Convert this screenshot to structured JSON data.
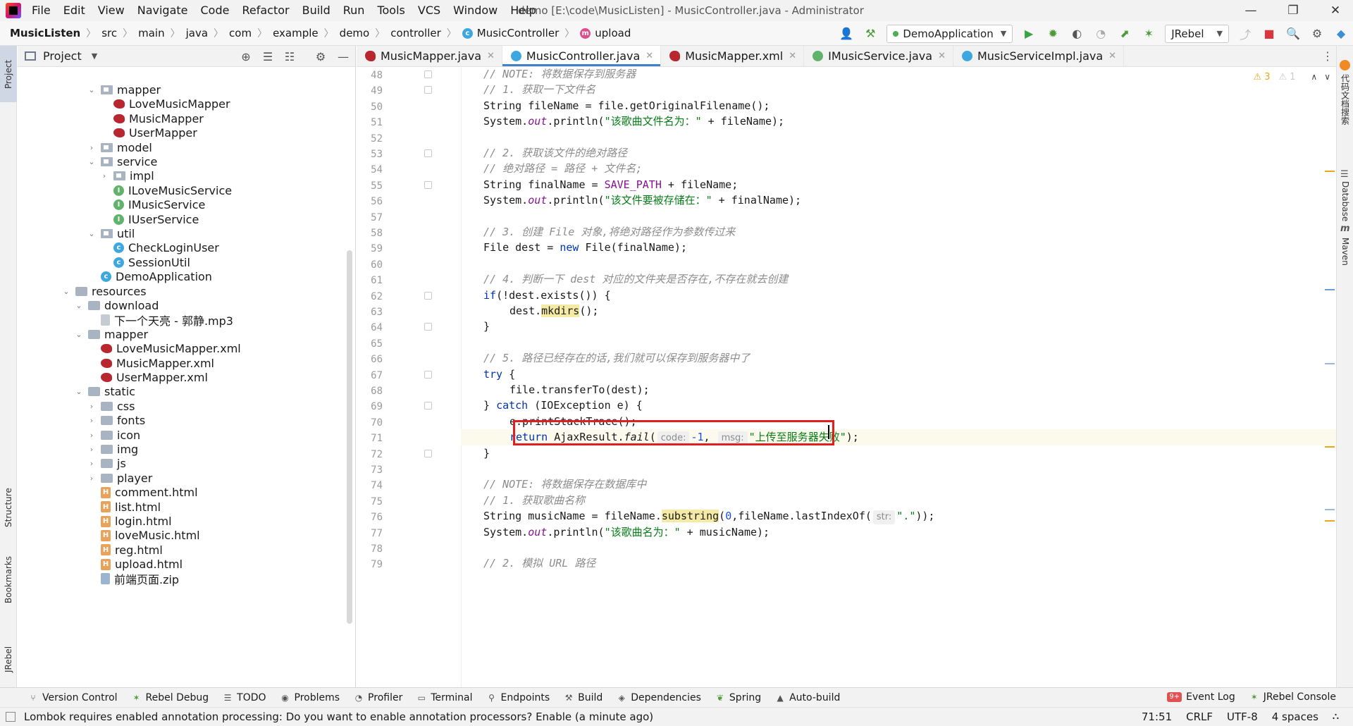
{
  "menu": {
    "items": [
      "File",
      "Edit",
      "View",
      "Navigate",
      "Code",
      "Refactor",
      "Build",
      "Run",
      "Tools",
      "VCS",
      "Window",
      "Help"
    ],
    "window_title": "demo [E:\\code\\MusicListen] - MusicController.java - Administrator"
  },
  "breadcrumb": {
    "project": "MusicListen",
    "parts": [
      "src",
      "main",
      "java",
      "com",
      "example",
      "demo",
      "controller"
    ],
    "class_name": "MusicController",
    "method_name": "upload"
  },
  "toolbar": {
    "run_config": "DemoApplication",
    "jrebel": "JRebel"
  },
  "left_strip": {
    "project_tab": "Project",
    "structure_tab": "Structure",
    "bookmarks_tab": "Bookmarks",
    "jrebel_tab": "JRebel"
  },
  "project_panel": {
    "title": "Project",
    "tree": [
      {
        "label": "mapper",
        "icon": "package",
        "depth": 1,
        "arrow": "open"
      },
      {
        "label": "LoveMusicMapper",
        "icon": "mybatis-bird",
        "depth": 2,
        "arrow": "none"
      },
      {
        "label": "MusicMapper",
        "icon": "mybatis-bird",
        "depth": 2,
        "arrow": "none"
      },
      {
        "label": "UserMapper",
        "icon": "mybatis-bird",
        "depth": 2,
        "arrow": "none"
      },
      {
        "label": "model",
        "icon": "package",
        "depth": 1,
        "arrow": "closed"
      },
      {
        "label": "service",
        "icon": "package",
        "depth": 1,
        "arrow": "open"
      },
      {
        "label": "impl",
        "icon": "package",
        "depth": 2,
        "arrow": "closed"
      },
      {
        "label": "ILoveMusicService",
        "icon": "interface",
        "depth": 2,
        "arrow": "none"
      },
      {
        "label": "IMusicService",
        "icon": "interface",
        "depth": 2,
        "arrow": "none"
      },
      {
        "label": "IUserService",
        "icon": "interface",
        "depth": 2,
        "arrow": "none"
      },
      {
        "label": "util",
        "icon": "package",
        "depth": 1,
        "arrow": "open"
      },
      {
        "label": "CheckLoginUser",
        "icon": "class",
        "depth": 2,
        "arrow": "none"
      },
      {
        "label": "SessionUtil",
        "icon": "class",
        "depth": 2,
        "arrow": "none"
      },
      {
        "label": "DemoApplication",
        "icon": "class",
        "depth": 1,
        "arrow": "none"
      },
      {
        "label": "resources",
        "icon": "folder",
        "depth": -1,
        "arrow": "open"
      },
      {
        "label": "download",
        "icon": "folder",
        "depth": 0,
        "arrow": "open"
      },
      {
        "label": "下一个天亮 - 郭静.mp3",
        "icon": "file",
        "depth": 1,
        "arrow": "none"
      },
      {
        "label": "mapper",
        "icon": "folder",
        "depth": 0,
        "arrow": "open"
      },
      {
        "label": "LoveMusicMapper.xml",
        "icon": "mybatis-bird",
        "depth": 1,
        "arrow": "none"
      },
      {
        "label": "MusicMapper.xml",
        "icon": "mybatis-bird",
        "depth": 1,
        "arrow": "none"
      },
      {
        "label": "UserMapper.xml",
        "icon": "mybatis-bird",
        "depth": 1,
        "arrow": "none"
      },
      {
        "label": "static",
        "icon": "folder",
        "depth": 0,
        "arrow": "open"
      },
      {
        "label": "css",
        "icon": "folder",
        "depth": 1,
        "arrow": "closed"
      },
      {
        "label": "fonts",
        "icon": "folder",
        "depth": 1,
        "arrow": "closed"
      },
      {
        "label": "icon",
        "icon": "folder",
        "depth": 1,
        "arrow": "closed"
      },
      {
        "label": "img",
        "icon": "folder",
        "depth": 1,
        "arrow": "closed"
      },
      {
        "label": "js",
        "icon": "folder",
        "depth": 1,
        "arrow": "closed"
      },
      {
        "label": "player",
        "icon": "folder",
        "depth": 1,
        "arrow": "closed"
      },
      {
        "label": "comment.html",
        "icon": "html",
        "depth": 1,
        "arrow": "none"
      },
      {
        "label": "list.html",
        "icon": "html",
        "depth": 1,
        "arrow": "none"
      },
      {
        "label": "login.html",
        "icon": "html",
        "depth": 1,
        "arrow": "none"
      },
      {
        "label": "loveMusic.html",
        "icon": "html",
        "depth": 1,
        "arrow": "none"
      },
      {
        "label": "reg.html",
        "icon": "html",
        "depth": 1,
        "arrow": "none"
      },
      {
        "label": "upload.html",
        "icon": "html",
        "depth": 1,
        "arrow": "none"
      },
      {
        "label": "前端页面.zip",
        "icon": "zip",
        "depth": 1,
        "arrow": "none"
      }
    ]
  },
  "editor_tabs": [
    {
      "label": "MusicMapper.java",
      "icon": "mybatis-bird",
      "active": false
    },
    {
      "label": "MusicController.java",
      "icon": "class",
      "active": true
    },
    {
      "label": "MusicMapper.xml",
      "icon": "mybatis-bird",
      "active": false
    },
    {
      "label": "IMusicService.java",
      "icon": "interface",
      "active": false
    },
    {
      "label": "MusicServiceImpl.java",
      "icon": "class",
      "active": false
    }
  ],
  "inspections": {
    "warnings": "3",
    "weak_warnings": "1"
  },
  "code": {
    "current_line": 71,
    "lines": [
      {
        "n": "48",
        "fold": true,
        "indent": 1,
        "tokens": [
          [
            "cm",
            "// NOTE: 将数据保存到服务器"
          ]
        ]
      },
      {
        "n": "49",
        "fold": true,
        "indent": 1,
        "tokens": [
          [
            "cm",
            "// 1. 获取一下文件名"
          ]
        ]
      },
      {
        "n": "50",
        "fold": false,
        "indent": 1,
        "tokens": [
          [
            "p",
            "String fileName = file.getOriginalFilename();"
          ]
        ]
      },
      {
        "n": "51",
        "fold": false,
        "indent": 1,
        "tokens": [
          [
            "p",
            "System."
          ],
          [
            "fld",
            "out"
          ],
          [
            "p",
            ".println("
          ],
          [
            "str",
            "\"该歌曲文件名为：\""
          ],
          [
            "p",
            " + fileName);"
          ]
        ]
      },
      {
        "n": "52",
        "fold": false,
        "indent": 0,
        "tokens": []
      },
      {
        "n": "53",
        "fold": true,
        "indent": 1,
        "tokens": [
          [
            "cm",
            "// 2. 获取该文件的绝对路径"
          ]
        ]
      },
      {
        "n": "54",
        "fold": false,
        "indent": 1,
        "tokens": [
          [
            "cm",
            "// 绝对路径 = 路径 + 文件名;"
          ]
        ]
      },
      {
        "n": "55",
        "fold": true,
        "indent": 1,
        "tokens": [
          [
            "p",
            "String finalName = "
          ],
          [
            "const",
            "SAVE_PATH"
          ],
          [
            "p",
            " + fileName;"
          ]
        ]
      },
      {
        "n": "56",
        "fold": false,
        "indent": 1,
        "tokens": [
          [
            "p",
            "System."
          ],
          [
            "fld",
            "out"
          ],
          [
            "p",
            ".println("
          ],
          [
            "str",
            "\"该文件要被存储在：\""
          ],
          [
            "p",
            " + finalName);"
          ]
        ]
      },
      {
        "n": "57",
        "fold": false,
        "indent": 0,
        "tokens": []
      },
      {
        "n": "58",
        "fold": false,
        "indent": 1,
        "tokens": [
          [
            "cm",
            "// 3. 创建 File 对象,将绝对路径作为参数传过来"
          ]
        ]
      },
      {
        "n": "59",
        "fold": false,
        "indent": 1,
        "tokens": [
          [
            "p",
            "File dest = "
          ],
          [
            "kw",
            "new"
          ],
          [
            "p",
            " File(finalName);"
          ]
        ]
      },
      {
        "n": "60",
        "fold": false,
        "indent": 0,
        "tokens": []
      },
      {
        "n": "61",
        "fold": false,
        "indent": 1,
        "tokens": [
          [
            "cm",
            "// 4. 判断一下 dest 对应的文件夹是否存在,不存在就去创建"
          ]
        ]
      },
      {
        "n": "62",
        "fold": true,
        "indent": 1,
        "tokens": [
          [
            "kw",
            "if"
          ],
          [
            "p",
            "(!dest.exists()) {"
          ]
        ]
      },
      {
        "n": "63",
        "fold": false,
        "indent": 2,
        "tokens": [
          [
            "p",
            "dest."
          ],
          [
            "hl",
            "mkdirs"
          ],
          [
            "p",
            "();"
          ]
        ]
      },
      {
        "n": "64",
        "fold": true,
        "indent": 1,
        "tokens": [
          [
            "p",
            "}"
          ]
        ]
      },
      {
        "n": "65",
        "fold": false,
        "indent": 0,
        "tokens": []
      },
      {
        "n": "66",
        "fold": false,
        "indent": 1,
        "tokens": [
          [
            "cm",
            "// 5. 路径已经存在的话,我们就可以保存到服务器中了"
          ]
        ]
      },
      {
        "n": "67",
        "fold": true,
        "indent": 1,
        "tokens": [
          [
            "kw",
            "try"
          ],
          [
            "p",
            " {"
          ]
        ]
      },
      {
        "n": "68",
        "fold": false,
        "indent": 2,
        "tokens": [
          [
            "p",
            "file.transferTo(dest);"
          ]
        ]
      },
      {
        "n": "69",
        "fold": true,
        "indent": 1,
        "tokens": [
          [
            "p",
            "} "
          ],
          [
            "kw",
            "catch"
          ],
          [
            "p",
            " (IOException e) {"
          ]
        ]
      },
      {
        "n": "70",
        "fold": false,
        "indent": 2,
        "tokens": [
          [
            "p",
            "e.printStackTrace();"
          ]
        ]
      },
      {
        "n": "71",
        "fold": false,
        "indent": 2,
        "tokens": [
          [
            "kw",
            "return"
          ],
          [
            "p",
            " AjaxResult."
          ],
          [
            "it",
            "fail"
          ],
          [
            "p",
            "("
          ],
          [
            "hint",
            "code:"
          ],
          [
            "num",
            "-1"
          ],
          [
            "p",
            ", "
          ],
          [
            "hint",
            "msg:"
          ],
          [
            "str",
            "\"上传至服务器失败\""
          ],
          [
            "p",
            ");"
          ]
        ]
      },
      {
        "n": "72",
        "fold": true,
        "indent": 1,
        "tokens": [
          [
            "p",
            "}"
          ]
        ]
      },
      {
        "n": "73",
        "fold": false,
        "indent": 0,
        "tokens": []
      },
      {
        "n": "74",
        "fold": false,
        "indent": 1,
        "tokens": [
          [
            "cm",
            "// NOTE: 将数据保存在数据库中"
          ]
        ]
      },
      {
        "n": "75",
        "fold": false,
        "indent": 1,
        "tokens": [
          [
            "cm",
            "// 1. 获取歌曲名称"
          ]
        ]
      },
      {
        "n": "76",
        "fold": false,
        "indent": 1,
        "tokens": [
          [
            "p",
            "String musicName = fileName."
          ],
          [
            "hl",
            "substring"
          ],
          [
            "p",
            "("
          ],
          [
            "num",
            "0"
          ],
          [
            "p",
            ",fileName.lastIndexOf("
          ],
          [
            "hint",
            "str:"
          ],
          [
            "str",
            "\".\""
          ],
          [
            "p",
            "));"
          ]
        ]
      },
      {
        "n": "77",
        "fold": false,
        "indent": 1,
        "tokens": [
          [
            "p",
            "System."
          ],
          [
            "fld",
            "out"
          ],
          [
            "p",
            ".println("
          ],
          [
            "str",
            "\"该歌曲名为：\""
          ],
          [
            "p",
            " + musicName);"
          ]
        ]
      },
      {
        "n": "78",
        "fold": false,
        "indent": 0,
        "tokens": []
      },
      {
        "n": "79",
        "fold": false,
        "indent": 1,
        "tokens": [
          [
            "cm",
            "// 2. 模拟 URL 路径"
          ]
        ]
      }
    ]
  },
  "right_strip": {
    "plugin_tab": "代码文档搜索",
    "database_tab": "Database",
    "maven_tab": "Maven"
  },
  "bottom_tools": {
    "left": [
      "Version Control",
      "Rebel Debug",
      "TODO",
      "Problems",
      "Profiler",
      "Terminal",
      "Endpoints",
      "Build",
      "Dependencies",
      "Spring",
      "Auto-build"
    ],
    "event_log": "Event Log",
    "event_log_badge": "9+",
    "jrebel_console": "JRebel Console"
  },
  "status": {
    "message": "Lombok requires enabled annotation processing: Do you want to enable annotation processors? Enable (a minute ago)",
    "position": "71:51",
    "line_sep": "CRLF",
    "encoding": "UTF-8",
    "indent": "4 spaces"
  },
  "colors": {
    "highlight_box": "#e02020",
    "keyword": "#0033b3",
    "string": "#067d17",
    "comment": "#8c8c8c"
  }
}
